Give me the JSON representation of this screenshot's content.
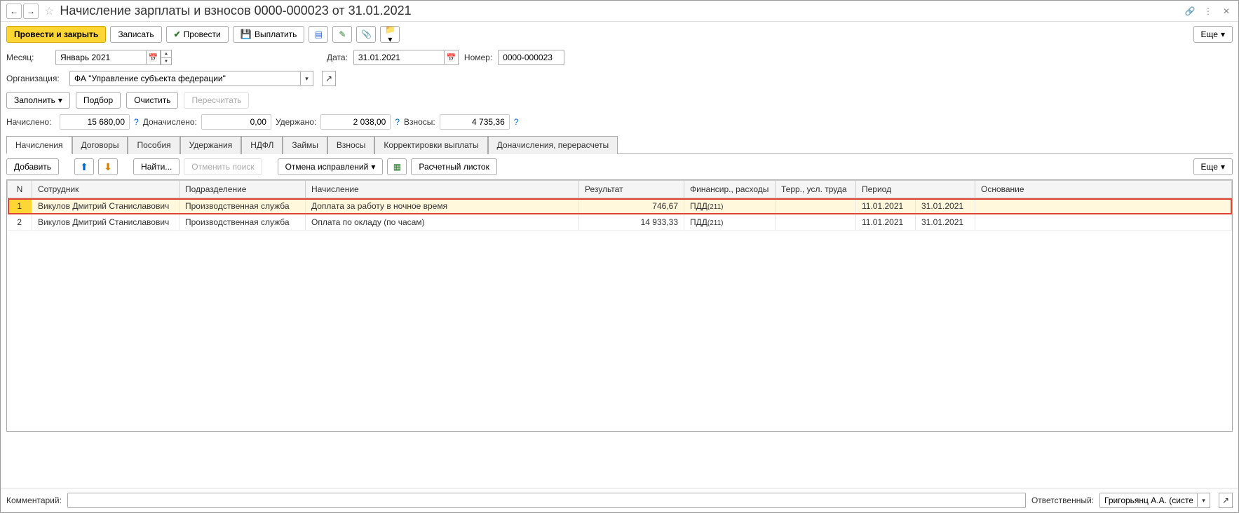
{
  "title": "Начисление зарплаты и взносов 0000-000023 от 31.01.2021",
  "toolbar": {
    "post_close": "Провести и закрыть",
    "save": "Записать",
    "post": "Провести",
    "pay": "Выплатить",
    "more": "Еще"
  },
  "form": {
    "month_label": "Месяц:",
    "month_value": "Январь 2021",
    "date_label": "Дата:",
    "date_value": "31.01.2021",
    "number_label": "Номер:",
    "number_value": "0000-000023",
    "org_label": "Организация:",
    "org_value": "ФА \"Управление субъекта федерации\""
  },
  "actions": {
    "fill": "Заполнить",
    "pick": "Подбор",
    "clear": "Очистить",
    "recalc": "Пересчитать"
  },
  "totals": {
    "accrued_label": "Начислено:",
    "accrued_value": "15 680,00",
    "extra_label": "Доначислено:",
    "extra_value": "0,00",
    "withheld_label": "Удержано:",
    "withheld_value": "2 038,00",
    "contrib_label": "Взносы:",
    "contrib_value": "4 735,36"
  },
  "tabs": [
    "Начисления",
    "Договоры",
    "Пособия",
    "Удержания",
    "НДФЛ",
    "Займы",
    "Взносы",
    "Корректировки выплаты",
    "Доначисления, перерасчеты"
  ],
  "tab_toolbar": {
    "add": "Добавить",
    "find": "Найти...",
    "cancel_search": "Отменить поиск",
    "cancel_fixes": "Отмена исправлений",
    "payslip": "Расчетный листок",
    "more": "Еще"
  },
  "columns": [
    "N",
    "Сотрудник",
    "Подразделение",
    "Начисление",
    "Результат",
    "Финансир., расходы",
    "Терр., усл. труда",
    "Период",
    "Основание"
  ],
  "rows": [
    {
      "n": "1",
      "emp": "Викулов Дмитрий Станиславович",
      "dept": "Производственная служба",
      "accr": "Доплата за работу в ночное время",
      "res": "746,67",
      "fin": "ПДД",
      "fin_code": "(211)",
      "terr": "",
      "p1": "11.01.2021",
      "p2": "31.01.2021",
      "base": ""
    },
    {
      "n": "2",
      "emp": "Викулов Дмитрий Станиславович",
      "dept": "Производственная служба",
      "accr": "Оплата по окладу (по часам)",
      "res": "14 933,33",
      "fin": "ПДД",
      "fin_code": "(211)",
      "terr": "",
      "p1": "11.01.2021",
      "p2": "31.01.2021",
      "base": ""
    }
  ],
  "footer": {
    "comment_label": "Комментарий:",
    "resp_label": "Ответственный:",
    "resp_value": "Григорьянц А.А. (системн"
  }
}
